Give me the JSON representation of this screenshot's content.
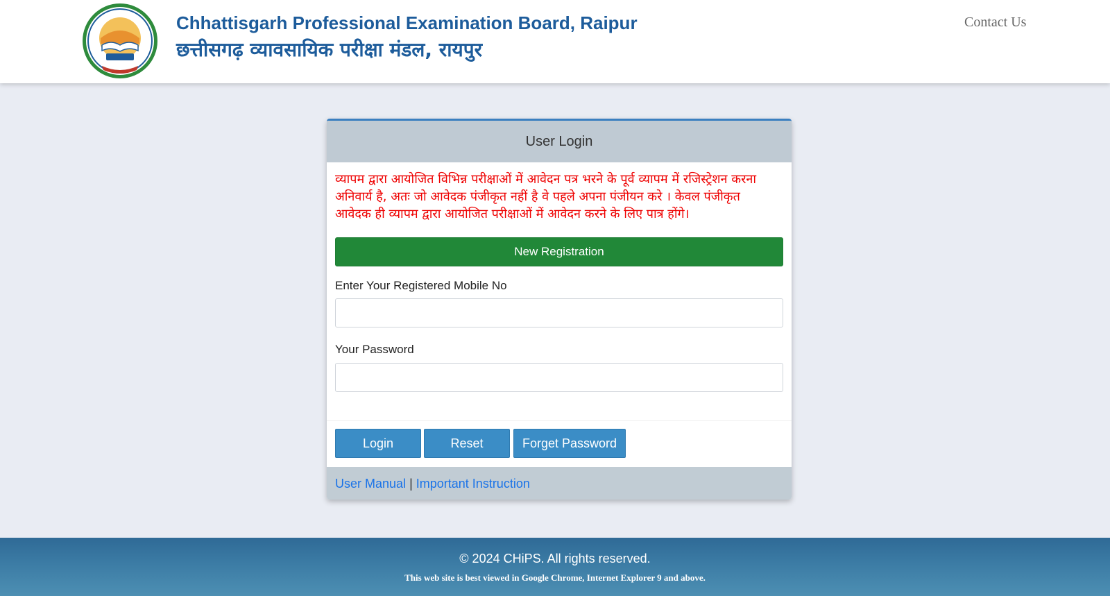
{
  "header": {
    "org_name_en": "Chhattisgarh Professional Examination Board, Raipur",
    "org_name_hi": "छत्तीसगढ़ व्यावसायिक परीक्षा मंडल, रायपुर",
    "contact_label": "Contact Us",
    "logo_icon": "vyapam-emblem-icon"
  },
  "login": {
    "title": "User Login",
    "notice": "व्यापम द्वारा आयोजित विभिन्न  परीक्षाओं में आवेदन पत्र भरने के पूर्व व्यापम में रजिस्ट्रेशन करना अनिवार्य है, अतः जो आवेदक पंजीकृत नहीं है वे पहले अपना  पंजीयन करे ।  केवल पंजीकृत आवेदक ही व्यापम द्वारा आयोजित परीक्षाओं में आवेदन करने के लिए पात्र होंगे।",
    "new_registration": "New Registration",
    "mobile_label": "Enter Your Registered Mobile No",
    "mobile_value": "",
    "password_label": "Your Password",
    "password_value": "",
    "login_btn": "Login",
    "reset_btn": "Reset",
    "forget_btn": "Forget Password",
    "user_manual": "User Manual",
    "separator": "|",
    "important_instruction": "Important Instruction"
  },
  "footer": {
    "copyright": "© 2024 CHiPS. All rights reserved.",
    "browser_note": "This web site is best viewed in Google Chrome, Internet Explorer 9 and above."
  },
  "colors": {
    "brand_blue": "#1d5c9b",
    "notice_red": "#ee0000",
    "register_green": "#218838",
    "button_blue": "#3b8dc6",
    "link_blue": "#1a73e8"
  }
}
